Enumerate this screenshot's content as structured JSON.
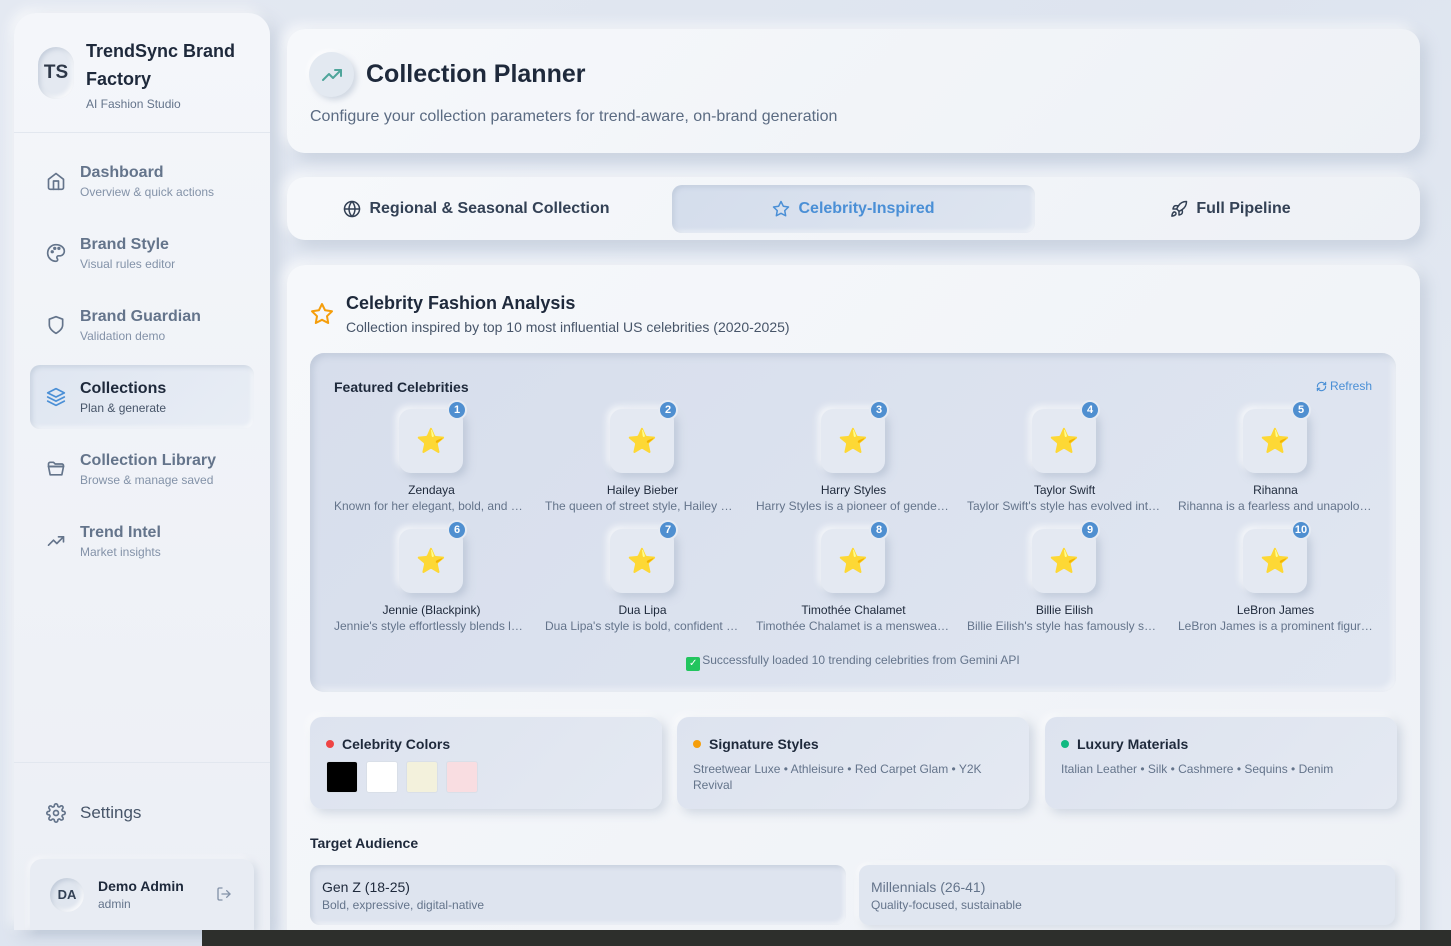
{
  "brand": {
    "logo": "TS",
    "title": "TrendSync Brand Factory",
    "subtitle": "AI Fashion Studio"
  },
  "nav": {
    "items": [
      {
        "label": "Dashboard",
        "sub": "Overview & quick actions",
        "icon": "home-icon"
      },
      {
        "label": "Brand Style",
        "sub": "Visual rules editor",
        "icon": "palette-icon"
      },
      {
        "label": "Brand Guardian",
        "sub": "Validation demo",
        "icon": "shield-icon"
      },
      {
        "label": "Collections",
        "sub": "Plan & generate",
        "icon": "layers-icon",
        "active": true
      },
      {
        "label": "Collection Library",
        "sub": "Browse & manage saved",
        "icon": "folder-icon"
      },
      {
        "label": "Trend Intel",
        "sub": "Market insights",
        "icon": "trend-icon"
      }
    ],
    "settings": "Settings"
  },
  "user": {
    "initials": "DA",
    "name": "Demo Admin",
    "role": "admin"
  },
  "header": {
    "title": "Collection Planner",
    "subtitle": "Configure your collection parameters for trend-aware, on-brand generation"
  },
  "tabs": [
    {
      "label": "Regional & Seasonal Collection",
      "icon": "globe-icon"
    },
    {
      "label": "Celebrity-Inspired",
      "icon": "star-icon",
      "active": true
    },
    {
      "label": "Full Pipeline",
      "icon": "rocket-icon"
    }
  ],
  "section": {
    "title": "Celebrity Fashion Analysis",
    "subtitle": "Collection inspired by top 10 most influential US celebrities (2020-2025)"
  },
  "featured": {
    "title": "Featured Celebrities",
    "refresh": "Refresh",
    "star_glyph": "⭐",
    "celebrities": [
      {
        "rank": "1",
        "name": "Zendaya",
        "desc": "Known for her elegant, bold, and experimental looks"
      },
      {
        "rank": "2",
        "name": "Hailey Bieber",
        "desc": "The queen of street style, Hailey Bieber"
      },
      {
        "rank": "3",
        "name": "Harry Styles",
        "desc": "Harry Styles is a pioneer of gender-fluid fashion"
      },
      {
        "rank": "4",
        "name": "Taylor Swift",
        "desc": "Taylor Swift's style has evolved into classic chic"
      },
      {
        "rank": "5",
        "name": "Rihanna",
        "desc": "Rihanna is a fearless and unapologetic trendsetter"
      },
      {
        "rank": "6",
        "name": "Jennie (Blackpink)",
        "desc": "Jennie's style effortlessly blends luxury and street"
      },
      {
        "rank": "7",
        "name": "Dua Lipa",
        "desc": "Dua Lipa's style is bold, confident and playful"
      },
      {
        "rank": "8",
        "name": "Timothée Chalamet",
        "desc": "Timothée Chalamet is a menswear icon"
      },
      {
        "rank": "9",
        "name": "Billie Eilish",
        "desc": "Billie Eilish's style has famously shifted"
      },
      {
        "rank": "10",
        "name": "LeBron James",
        "desc": "LeBron James is a prominent figure in fashion"
      }
    ],
    "status": "Successfully loaded 10 trending celebrities from Gemini API"
  },
  "cards": {
    "colors": {
      "title": "Celebrity Colors",
      "dot": "#ef4444",
      "swatches": [
        "#000000",
        "#ffffff",
        "#f3f1dc",
        "#f9dde1"
      ]
    },
    "styles": {
      "title": "Signature Styles",
      "dot": "#f59e0b",
      "body": "Streetwear Luxe • Athleisure • Red Carpet Glam • Y2K Revival"
    },
    "materials": {
      "title": "Luxury Materials",
      "dot": "#10b981",
      "body": "Italian Leather • Silk • Cashmere • Sequins • Denim"
    }
  },
  "audience": {
    "label": "Target Audience",
    "options": [
      {
        "name": "Gen Z (18-25)",
        "desc": "Bold, expressive, digital-native",
        "active": true
      },
      {
        "name": "Millennials (26-41)",
        "desc": "Quality-focused, sustainable"
      }
    ]
  }
}
